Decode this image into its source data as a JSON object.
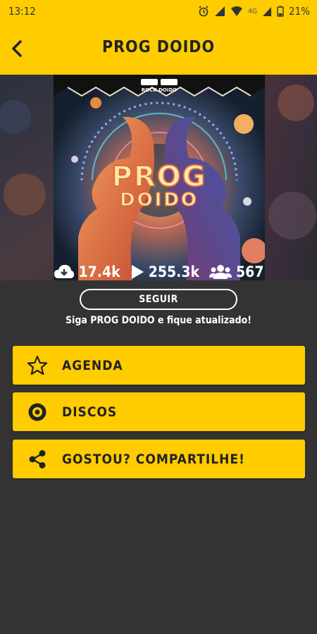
{
  "status_bar": {
    "time": "13:12",
    "network": "4G",
    "battery": "21%",
    "icons": [
      "alarm-icon",
      "signal-icon",
      "wifi-icon",
      "battery-icon"
    ]
  },
  "app_bar": {
    "title": "PROG DOIDO",
    "back_icon": "back-arrow-icon"
  },
  "cover": {
    "top_label": "ROCK DOIDO",
    "title_line1": "PROG",
    "title_line2": "DOIDO"
  },
  "stats": {
    "downloads": "17.4k",
    "plays": "255.3k",
    "followers": "567"
  },
  "follow": {
    "button_label": "SEGUIR",
    "caption": "Siga PROG DOIDO e fique atualizado!"
  },
  "menu": [
    {
      "label": "AGENDA",
      "icon": "star-icon"
    },
    {
      "label": "DISCOS",
      "icon": "disc-icon"
    },
    {
      "label": "GOSTOU? COMPARTILHE!",
      "icon": "share-icon"
    }
  ],
  "colors": {
    "accent": "#FFCC00",
    "background": "#333333",
    "text_dark": "#222222"
  }
}
